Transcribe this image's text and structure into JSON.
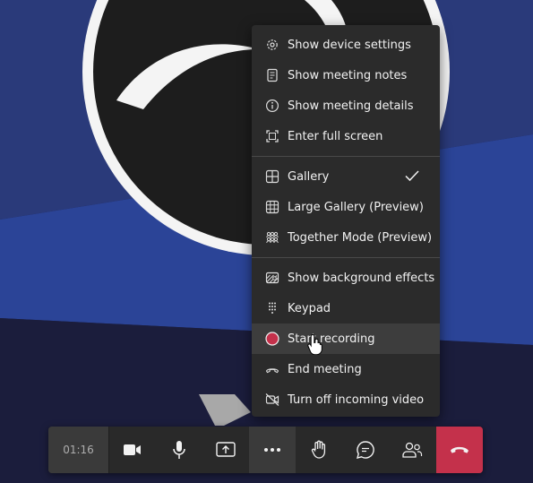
{
  "menu": {
    "items": [
      {
        "label": "Show device settings",
        "icon": "gear-icon"
      },
      {
        "label": "Show meeting notes",
        "icon": "notes-icon"
      },
      {
        "label": "Show meeting details",
        "icon": "info-icon"
      },
      {
        "label": "Enter full screen",
        "icon": "fullscreen-icon"
      },
      {
        "label": "Gallery",
        "icon": "gallery-icon",
        "checked": true
      },
      {
        "label": "Large Gallery (Preview)",
        "icon": "large-gallery-icon"
      },
      {
        "label": "Together Mode (Preview)",
        "icon": "together-mode-icon"
      },
      {
        "label": "Show background effects",
        "icon": "background-effects-icon"
      },
      {
        "label": "Keypad",
        "icon": "keypad-icon"
      },
      {
        "label": "Start recording",
        "icon": "record-icon",
        "hovered": true
      },
      {
        "label": "End meeting",
        "icon": "end-meeting-icon"
      },
      {
        "label": "Turn off incoming video",
        "icon": "video-off-icon"
      }
    ]
  },
  "toolbar": {
    "timer": "01:16",
    "buttons": [
      "camera-icon",
      "microphone-icon",
      "share-screen-icon",
      "more-options-icon",
      "raise-hand-icon",
      "chat-icon",
      "participants-icon",
      "hang-up-icon"
    ]
  },
  "colors": {
    "hangup": "#c4314b",
    "record": "#c4314b",
    "menu_bg": "#2b2b2b",
    "toolbar_bg": "#292929"
  }
}
